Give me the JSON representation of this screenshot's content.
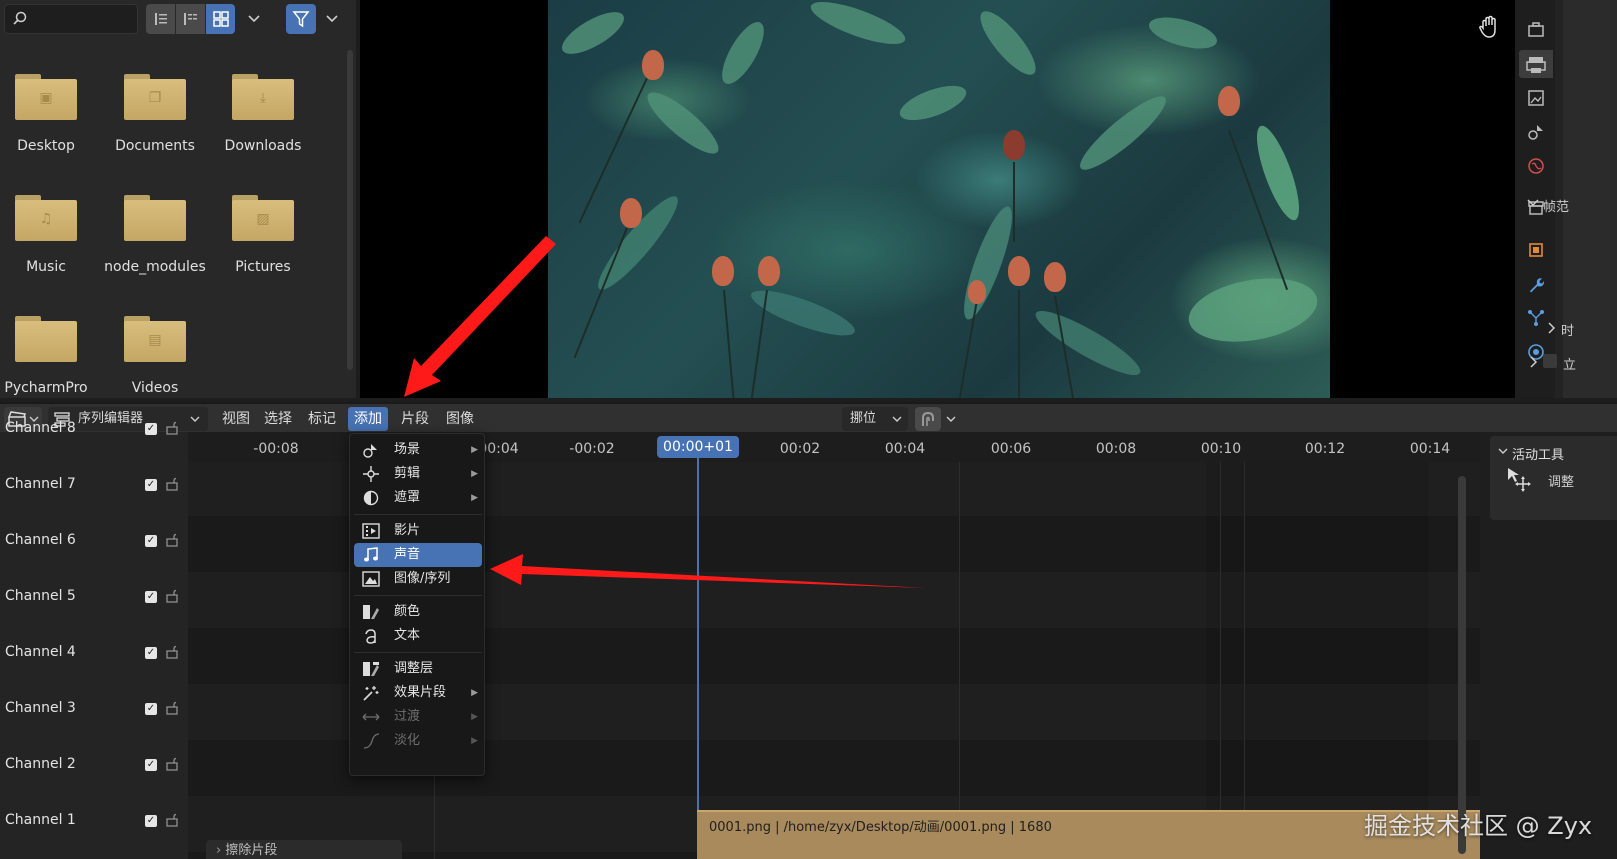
{
  "file_browser": {
    "folders": [
      {
        "name": "Desktop",
        "icon": "desktop-icon"
      },
      {
        "name": "Documents",
        "icon": "documents-icon"
      },
      {
        "name": "Downloads",
        "icon": "download-icon"
      },
      {
        "name": "Music",
        "icon": "music-note-icon"
      },
      {
        "name": "node_modules",
        "icon": "folder-icon"
      },
      {
        "name": "Pictures",
        "icon": "picture-icon"
      },
      {
        "name": "PycharmPro",
        "icon": "folder-icon"
      },
      {
        "name": "Videos",
        "icon": "film-icon"
      }
    ],
    "view_modes": [
      "vertical-list",
      "horizontal-list",
      "thumbnails"
    ],
    "active_view": "thumbnails"
  },
  "properties": {
    "rows": [
      "帧范",
      "时",
      "立"
    ]
  },
  "header": {
    "editor_type": "序列编辑器",
    "menus": [
      "视图",
      "选择",
      "标记",
      "添加",
      "片段",
      "图像"
    ],
    "active_menu": "添加",
    "overlap_mode": "挪位"
  },
  "channels": [
    "Channel 8",
    "Channel 7",
    "Channel 6",
    "Channel 5",
    "Channel 4",
    "Channel 3",
    "Channel 2",
    "Channel 1"
  ],
  "timeline": {
    "ticks": [
      "-00:08",
      "-00:04",
      "-00:02",
      "00:02",
      "00:04",
      "00:06",
      "00:08",
      "00:10",
      "00:12",
      "00:14"
    ],
    "current_time": "00:00+01",
    "strip_label": "0001.png | /home/zyx/Desktop/动画/0001.png | 1680",
    "erase_panel": "擦除片段"
  },
  "tool_panel": {
    "title": "活动工具",
    "item": "调整"
  },
  "add_menu": {
    "items": [
      {
        "label": "场景",
        "icon": "scene-icon",
        "submenu": true
      },
      {
        "label": "剪辑",
        "icon": "clip-icon",
        "submenu": true
      },
      {
        "label": "遮罩",
        "icon": "mask-icon",
        "submenu": true
      },
      {
        "label": "影片",
        "icon": "movie-icon",
        "submenu": false
      },
      {
        "label": "声音",
        "icon": "sound-icon",
        "submenu": false,
        "highlighted": true
      },
      {
        "label": "图像/序列",
        "icon": "image-icon",
        "submenu": false
      },
      {
        "label": "颜色",
        "icon": "color-icon",
        "submenu": false
      },
      {
        "label": "文本",
        "icon": "text-icon",
        "submenu": false
      },
      {
        "label": "调整层",
        "icon": "adjustment-icon",
        "submenu": false
      },
      {
        "label": "效果片段",
        "icon": "effect-icon",
        "submenu": true
      },
      {
        "label": "过渡",
        "icon": "transition-icon",
        "submenu": true,
        "disabled": true
      },
      {
        "label": "淡化",
        "icon": "fade-icon",
        "submenu": true,
        "disabled": true
      }
    ]
  },
  "colors": {
    "accent": "#4772b3",
    "strip": "#a88a5c",
    "folder": "#d8bd7d",
    "annotation_arrow": "#ff1a1a"
  },
  "watermark": "掘金技术社区 @ Zyx"
}
